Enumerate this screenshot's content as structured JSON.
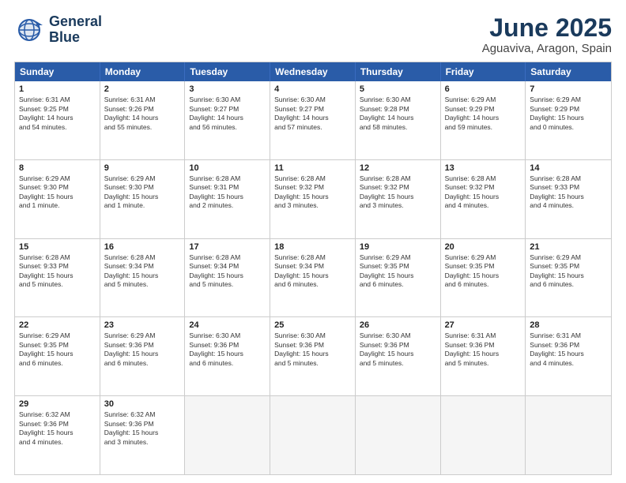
{
  "header": {
    "logo_line1": "General",
    "logo_line2": "Blue",
    "title": "June 2025",
    "subtitle": "Aguaviva, Aragon, Spain"
  },
  "weekdays": [
    "Sunday",
    "Monday",
    "Tuesday",
    "Wednesday",
    "Thursday",
    "Friday",
    "Saturday"
  ],
  "rows": [
    [
      {
        "day": "1",
        "lines": [
          "Sunrise: 6:31 AM",
          "Sunset: 9:25 PM",
          "Daylight: 14 hours",
          "and 54 minutes."
        ]
      },
      {
        "day": "2",
        "lines": [
          "Sunrise: 6:31 AM",
          "Sunset: 9:26 PM",
          "Daylight: 14 hours",
          "and 55 minutes."
        ]
      },
      {
        "day": "3",
        "lines": [
          "Sunrise: 6:30 AM",
          "Sunset: 9:27 PM",
          "Daylight: 14 hours",
          "and 56 minutes."
        ]
      },
      {
        "day": "4",
        "lines": [
          "Sunrise: 6:30 AM",
          "Sunset: 9:27 PM",
          "Daylight: 14 hours",
          "and 57 minutes."
        ]
      },
      {
        "day": "5",
        "lines": [
          "Sunrise: 6:30 AM",
          "Sunset: 9:28 PM",
          "Daylight: 14 hours",
          "and 58 minutes."
        ]
      },
      {
        "day": "6",
        "lines": [
          "Sunrise: 6:29 AM",
          "Sunset: 9:29 PM",
          "Daylight: 14 hours",
          "and 59 minutes."
        ]
      },
      {
        "day": "7",
        "lines": [
          "Sunrise: 6:29 AM",
          "Sunset: 9:29 PM",
          "Daylight: 15 hours",
          "and 0 minutes."
        ]
      }
    ],
    [
      {
        "day": "8",
        "lines": [
          "Sunrise: 6:29 AM",
          "Sunset: 9:30 PM",
          "Daylight: 15 hours",
          "and 1 minute."
        ]
      },
      {
        "day": "9",
        "lines": [
          "Sunrise: 6:29 AM",
          "Sunset: 9:30 PM",
          "Daylight: 15 hours",
          "and 1 minute."
        ]
      },
      {
        "day": "10",
        "lines": [
          "Sunrise: 6:28 AM",
          "Sunset: 9:31 PM",
          "Daylight: 15 hours",
          "and 2 minutes."
        ]
      },
      {
        "day": "11",
        "lines": [
          "Sunrise: 6:28 AM",
          "Sunset: 9:32 PM",
          "Daylight: 15 hours",
          "and 3 minutes."
        ]
      },
      {
        "day": "12",
        "lines": [
          "Sunrise: 6:28 AM",
          "Sunset: 9:32 PM",
          "Daylight: 15 hours",
          "and 3 minutes."
        ]
      },
      {
        "day": "13",
        "lines": [
          "Sunrise: 6:28 AM",
          "Sunset: 9:32 PM",
          "Daylight: 15 hours",
          "and 4 minutes."
        ]
      },
      {
        "day": "14",
        "lines": [
          "Sunrise: 6:28 AM",
          "Sunset: 9:33 PM",
          "Daylight: 15 hours",
          "and 4 minutes."
        ]
      }
    ],
    [
      {
        "day": "15",
        "lines": [
          "Sunrise: 6:28 AM",
          "Sunset: 9:33 PM",
          "Daylight: 15 hours",
          "and 5 minutes."
        ]
      },
      {
        "day": "16",
        "lines": [
          "Sunrise: 6:28 AM",
          "Sunset: 9:34 PM",
          "Daylight: 15 hours",
          "and 5 minutes."
        ]
      },
      {
        "day": "17",
        "lines": [
          "Sunrise: 6:28 AM",
          "Sunset: 9:34 PM",
          "Daylight: 15 hours",
          "and 5 minutes."
        ]
      },
      {
        "day": "18",
        "lines": [
          "Sunrise: 6:28 AM",
          "Sunset: 9:34 PM",
          "Daylight: 15 hours",
          "and 6 minutes."
        ]
      },
      {
        "day": "19",
        "lines": [
          "Sunrise: 6:29 AM",
          "Sunset: 9:35 PM",
          "Daylight: 15 hours",
          "and 6 minutes."
        ]
      },
      {
        "day": "20",
        "lines": [
          "Sunrise: 6:29 AM",
          "Sunset: 9:35 PM",
          "Daylight: 15 hours",
          "and 6 minutes."
        ]
      },
      {
        "day": "21",
        "lines": [
          "Sunrise: 6:29 AM",
          "Sunset: 9:35 PM",
          "Daylight: 15 hours",
          "and 6 minutes."
        ]
      }
    ],
    [
      {
        "day": "22",
        "lines": [
          "Sunrise: 6:29 AM",
          "Sunset: 9:35 PM",
          "Daylight: 15 hours",
          "and 6 minutes."
        ]
      },
      {
        "day": "23",
        "lines": [
          "Sunrise: 6:29 AM",
          "Sunset: 9:36 PM",
          "Daylight: 15 hours",
          "and 6 minutes."
        ]
      },
      {
        "day": "24",
        "lines": [
          "Sunrise: 6:30 AM",
          "Sunset: 9:36 PM",
          "Daylight: 15 hours",
          "and 6 minutes."
        ]
      },
      {
        "day": "25",
        "lines": [
          "Sunrise: 6:30 AM",
          "Sunset: 9:36 PM",
          "Daylight: 15 hours",
          "and 5 minutes."
        ]
      },
      {
        "day": "26",
        "lines": [
          "Sunrise: 6:30 AM",
          "Sunset: 9:36 PM",
          "Daylight: 15 hours",
          "and 5 minutes."
        ]
      },
      {
        "day": "27",
        "lines": [
          "Sunrise: 6:31 AM",
          "Sunset: 9:36 PM",
          "Daylight: 15 hours",
          "and 5 minutes."
        ]
      },
      {
        "day": "28",
        "lines": [
          "Sunrise: 6:31 AM",
          "Sunset: 9:36 PM",
          "Daylight: 15 hours",
          "and 4 minutes."
        ]
      }
    ],
    [
      {
        "day": "29",
        "lines": [
          "Sunrise: 6:32 AM",
          "Sunset: 9:36 PM",
          "Daylight: 15 hours",
          "and 4 minutes."
        ]
      },
      {
        "day": "30",
        "lines": [
          "Sunrise: 6:32 AM",
          "Sunset: 9:36 PM",
          "Daylight: 15 hours",
          "and 3 minutes."
        ]
      },
      {
        "day": "",
        "lines": []
      },
      {
        "day": "",
        "lines": []
      },
      {
        "day": "",
        "lines": []
      },
      {
        "day": "",
        "lines": []
      },
      {
        "day": "",
        "lines": []
      }
    ]
  ]
}
